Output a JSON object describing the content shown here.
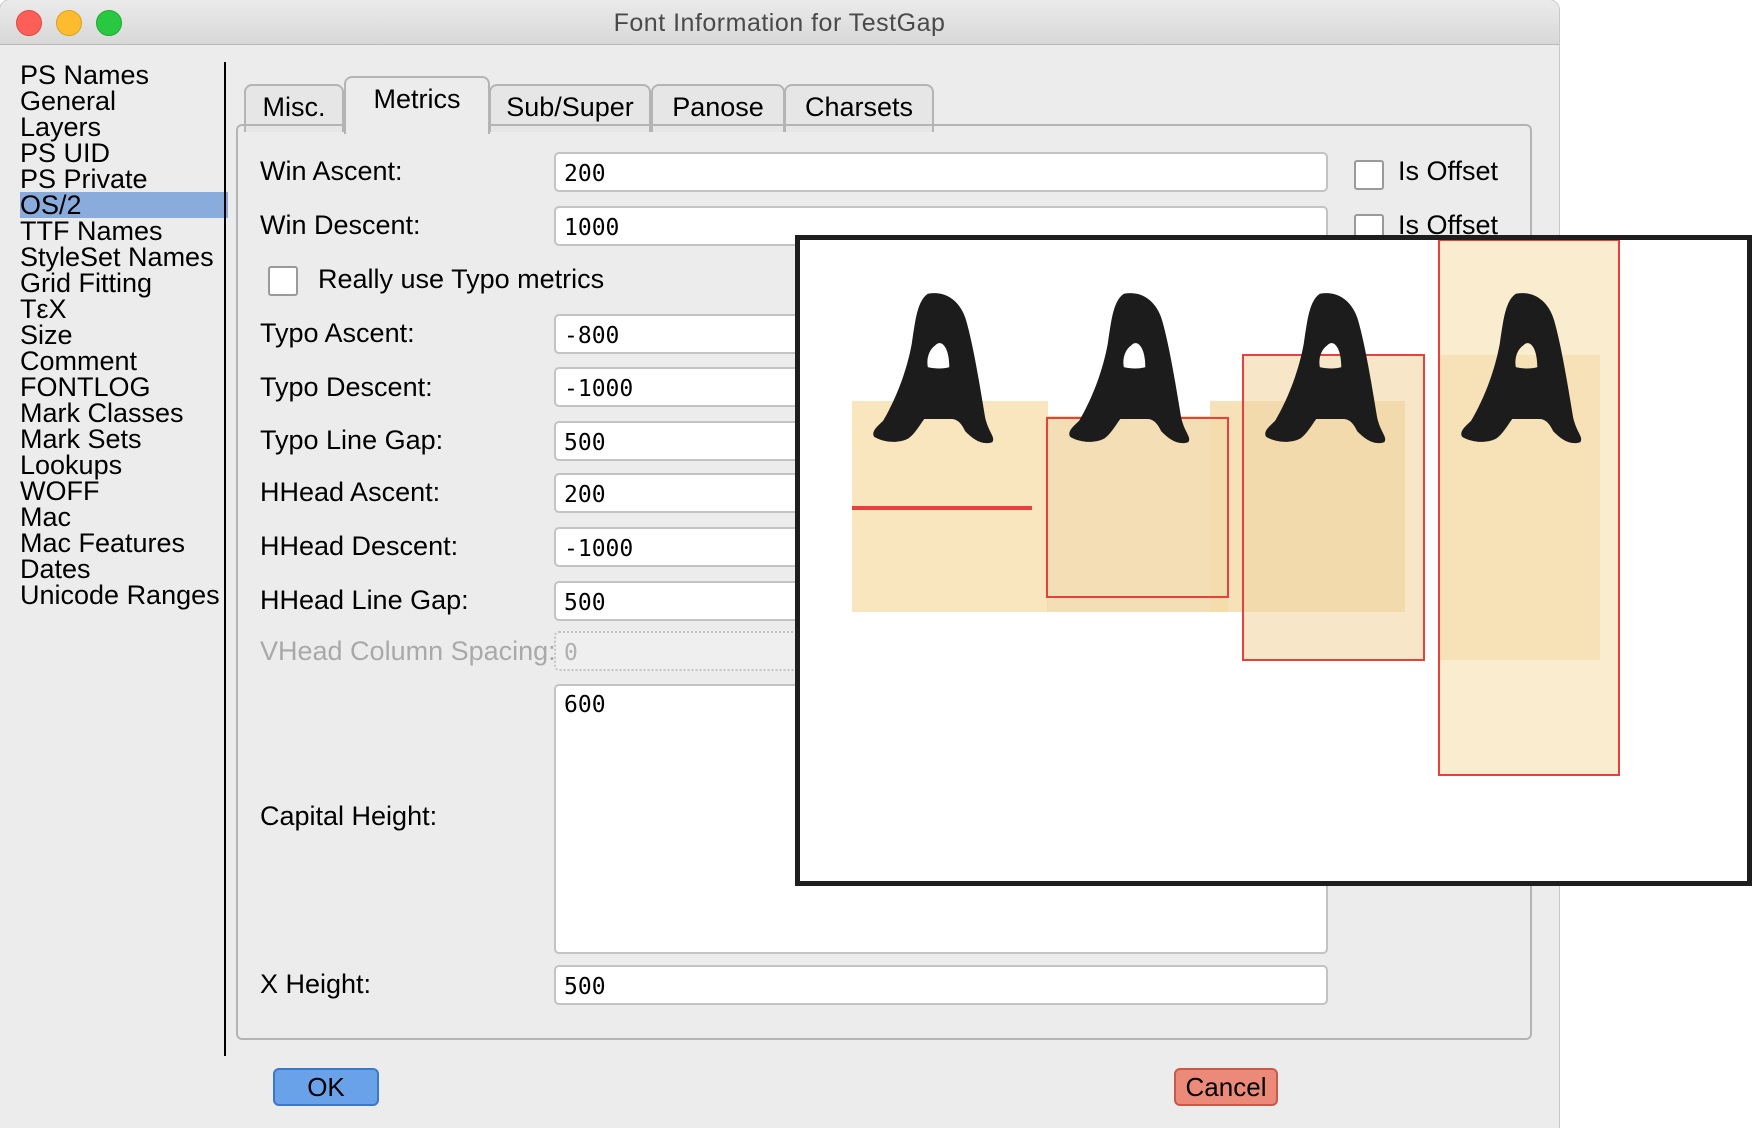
{
  "window": {
    "title": "Font Information for TestGap"
  },
  "sidebar": {
    "items": [
      {
        "label": "PS Names"
      },
      {
        "label": "General"
      },
      {
        "label": "Layers"
      },
      {
        "label": "PS UID"
      },
      {
        "label": "PS Private"
      },
      {
        "label": "OS/2",
        "selected": true
      },
      {
        "label": "TTF Names"
      },
      {
        "label": "StyleSet Names"
      },
      {
        "label": "Grid Fitting"
      },
      {
        "label": "TεX"
      },
      {
        "label": "Size"
      },
      {
        "label": "Comment"
      },
      {
        "label": "FONTLOG"
      },
      {
        "label": "Mark Classes"
      },
      {
        "label": "Mark Sets"
      },
      {
        "label": "Lookups"
      },
      {
        "label": "WOFF"
      },
      {
        "label": "Mac"
      },
      {
        "label": "Mac Features"
      },
      {
        "label": "Dates"
      },
      {
        "label": "Unicode Ranges"
      }
    ]
  },
  "tabs": [
    {
      "label": "Misc."
    },
    {
      "label": "Metrics",
      "active": true
    },
    {
      "label": "Sub/Super"
    },
    {
      "label": "Panose"
    },
    {
      "label": "Charsets"
    }
  ],
  "metrics": {
    "win_ascent": {
      "label": "Win Ascent:",
      "value": "200"
    },
    "win_descent": {
      "label": "Win Descent:",
      "value": "1000"
    },
    "is_offset_label": "Is Offset",
    "really_use_typo_label": "Really use Typo metrics",
    "typo_ascent": {
      "label": "Typo Ascent:",
      "value": "-800"
    },
    "typo_descent": {
      "label": "Typo Descent:",
      "value": "-1000"
    },
    "typo_line_gap": {
      "label": "Typo Line Gap:",
      "value": "500"
    },
    "hhead_ascent": {
      "label": "HHead Ascent:",
      "value": "200"
    },
    "hhead_descent": {
      "label": "HHead Descent:",
      "value": "-1000"
    },
    "hhead_line_gap": {
      "label": "HHead Line Gap:",
      "value": "500"
    },
    "vhead_column_spacing": {
      "label": "VHead Column Spacing:",
      "value": "0"
    },
    "capital_height": {
      "label": "Capital Height:",
      "value": "600"
    },
    "x_height": {
      "label": "X Height:",
      "value": "500"
    }
  },
  "buttons": {
    "ok": "OK",
    "cancel": "Cancel"
  },
  "preview": {
    "glyph": "A",
    "highlight_color": "#f8e2b4",
    "box_color": "#e8403c",
    "glyph_color": "#1c1c1c"
  }
}
